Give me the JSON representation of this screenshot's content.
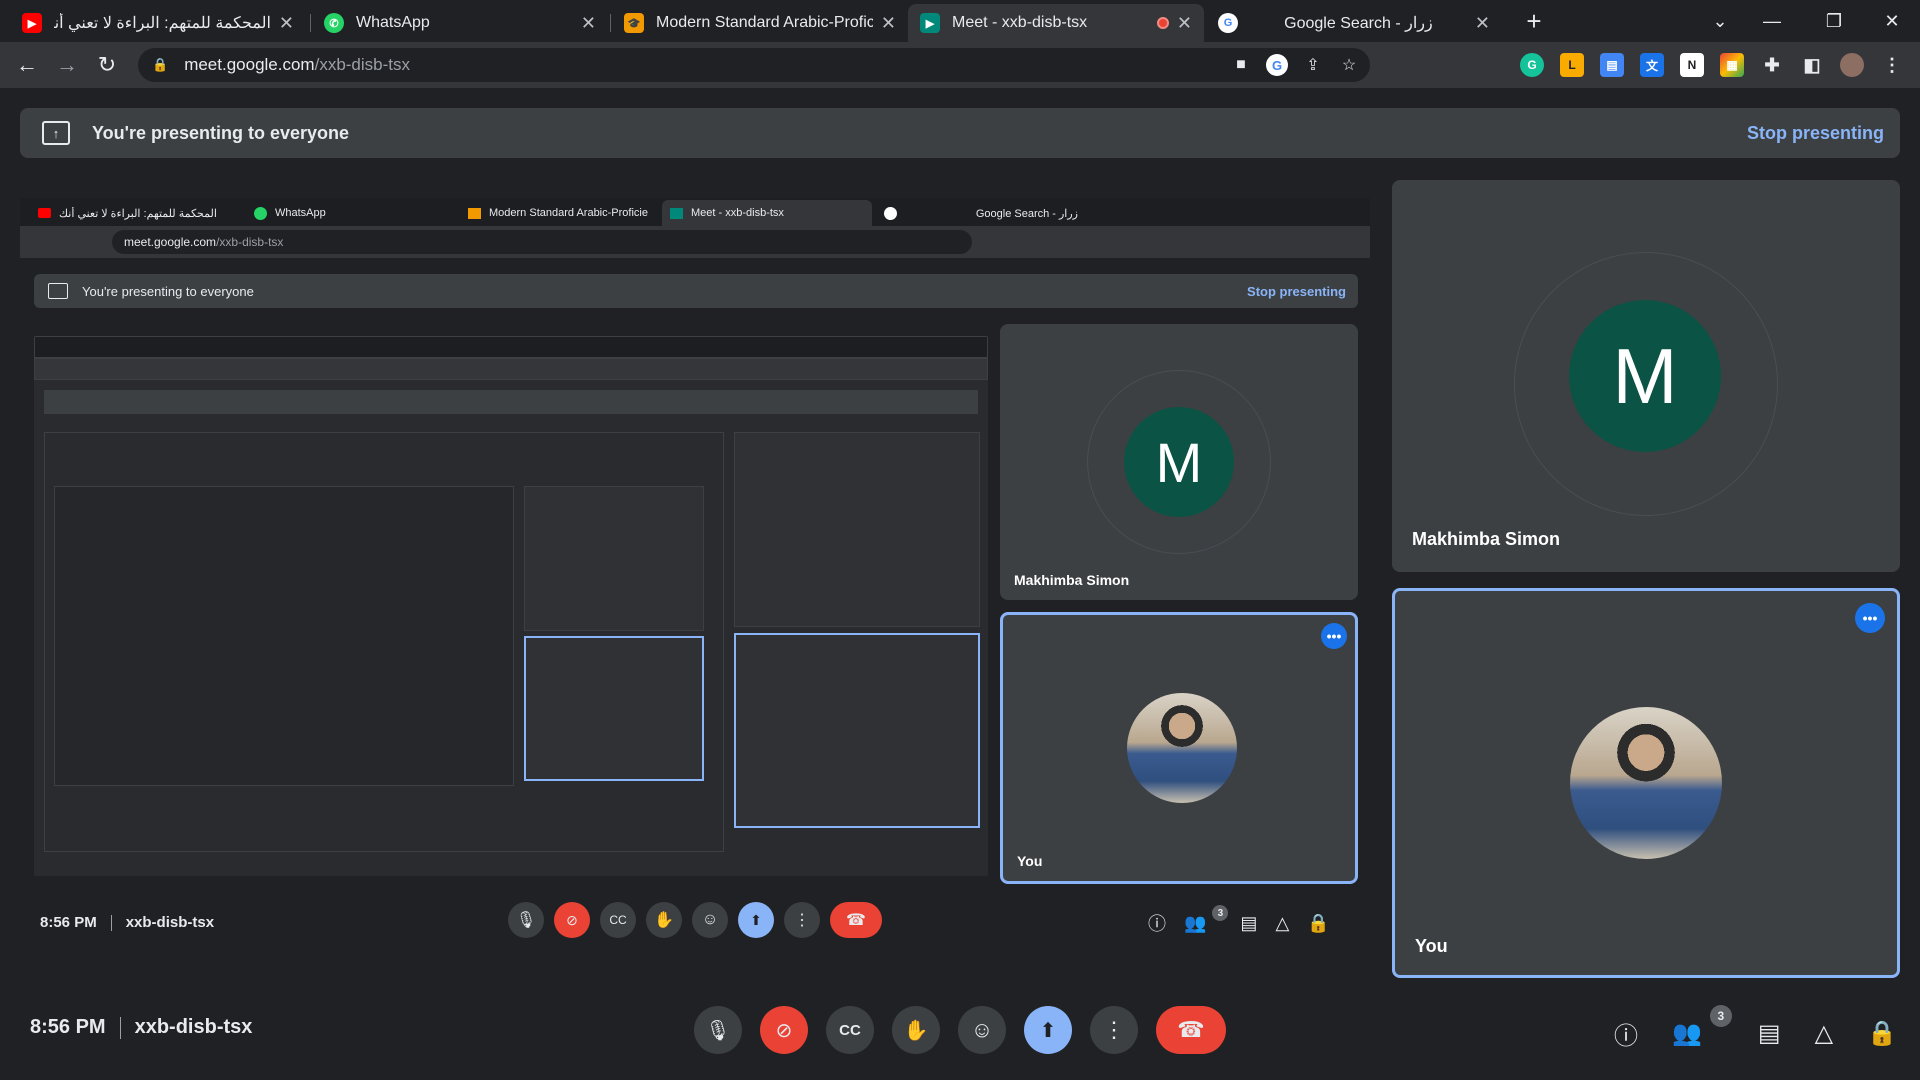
{
  "browser": {
    "tabs": [
      {
        "title": "المحكمة للمتهم: البراءة لا تعني أنك",
        "favicon": "youtube-icon"
      },
      {
        "title": "WhatsApp",
        "favicon": "whatsapp-icon"
      },
      {
        "title": "Modern Standard Arabic-Proficie",
        "favicon": "course-icon"
      },
      {
        "title": "Meet - xxb-disb-tsx",
        "favicon": "meet-icon"
      },
      {
        "title": "Google Search - زرار",
        "favicon": "google-icon"
      }
    ],
    "new_tab": "+",
    "url_host": "meet.google.com",
    "url_path": "/xxb-disb-tsx"
  },
  "banner": {
    "text": "You're presenting to everyone",
    "stop_label": "Stop presenting"
  },
  "participants": {
    "remote": {
      "name": "Makhimba Simon",
      "initial": "M"
    },
    "self": {
      "name": "You"
    }
  },
  "meeting": {
    "time": "8:56 PM",
    "code": "xxb-disb-tsx",
    "participant_count": "3"
  },
  "colors": {
    "accent": "#8ab4f8",
    "danger": "#ea4335",
    "avatar_bg": "#0b5345",
    "surface": "#3c4043",
    "background": "#202124"
  }
}
